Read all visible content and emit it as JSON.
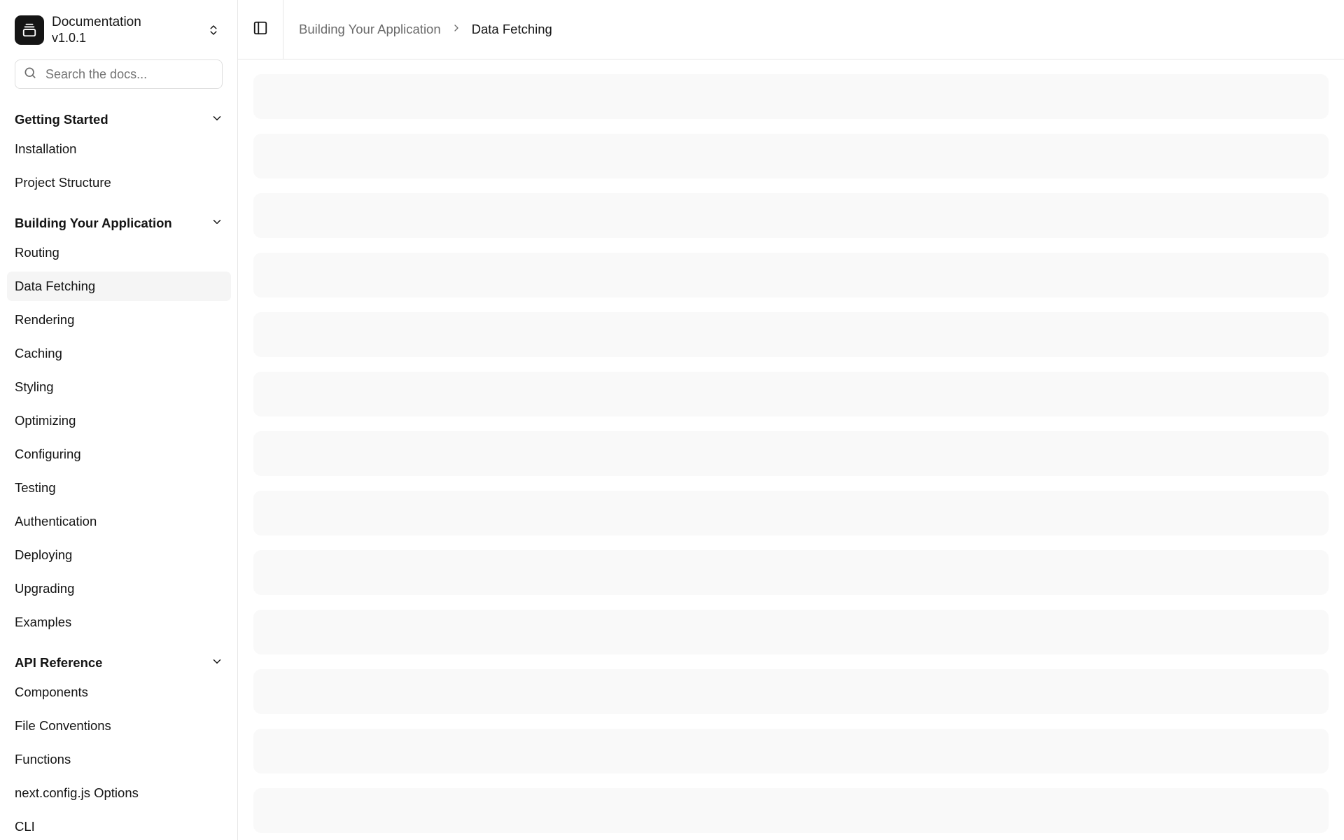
{
  "brand": {
    "title": "Documentation",
    "version": "v1.0.1"
  },
  "search": {
    "placeholder": "Search the docs..."
  },
  "sections": [
    {
      "title": "Getting Started",
      "items": [
        "Installation",
        "Project Structure"
      ]
    },
    {
      "title": "Building Your Application",
      "items": [
        "Routing",
        "Data Fetching",
        "Rendering",
        "Caching",
        "Styling",
        "Optimizing",
        "Configuring",
        "Testing",
        "Authentication",
        "Deploying",
        "Upgrading",
        "Examples"
      ]
    },
    {
      "title": "API Reference",
      "items": [
        "Components",
        "File Conventions",
        "Functions",
        "next.config.js Options",
        "CLI"
      ]
    }
  ],
  "active_item": "Data Fetching",
  "breadcrumb": {
    "parent": "Building Your Application",
    "current": "Data Fetching"
  },
  "icons": {
    "logo": "gallery-icon",
    "switcher": "chevrons-up-down-icon",
    "search": "search-icon",
    "section_toggle": "chevron-down-icon",
    "sidebar_toggle": "panel-left-icon",
    "breadcrumb_separator": "chevron-right-icon"
  },
  "skeleton_rows": 13,
  "colors": {
    "sidebar_active_bg": "#f5f5f5",
    "skeleton_bg": "#f9f9f9",
    "border": "#e7e7e7",
    "logo_bg": "#151515"
  }
}
